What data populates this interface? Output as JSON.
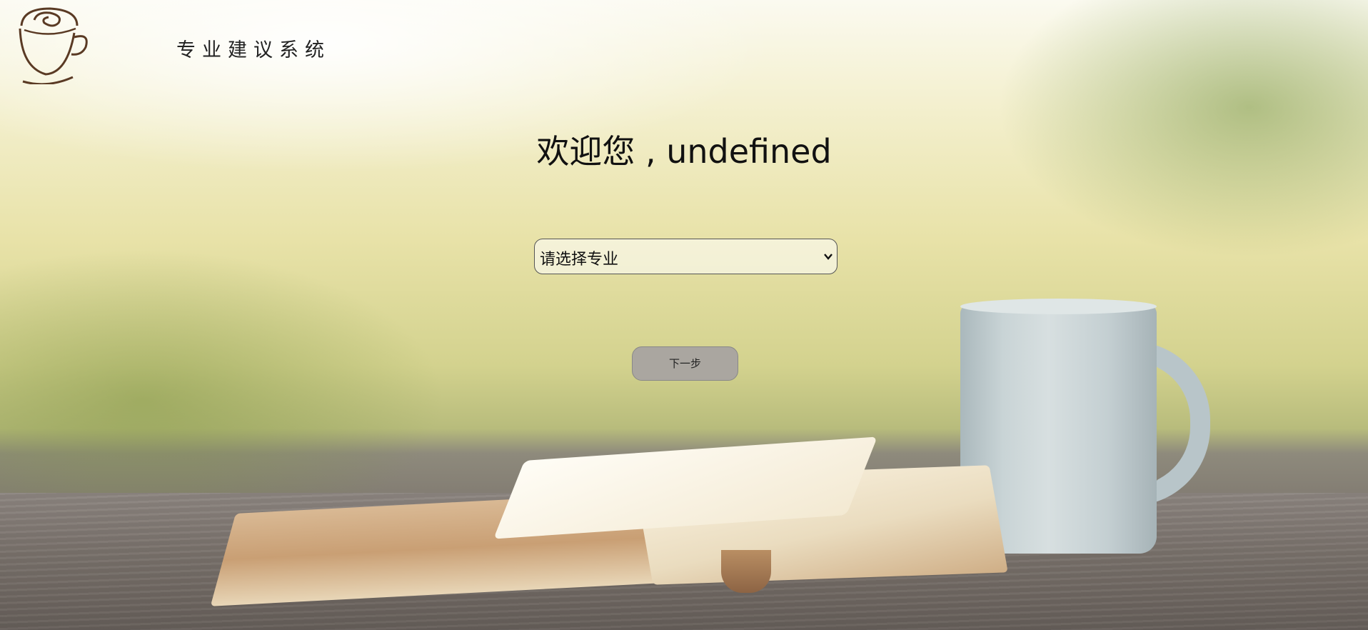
{
  "header": {
    "logo_icon": "coffee-cup-icon",
    "site_title": "专业建议系统"
  },
  "main": {
    "welcome_text": "欢迎您 , undefined",
    "major_select": {
      "selected_value": "请选择专业",
      "icon": "chevron-down-icon"
    },
    "next_button_label": "下一步"
  },
  "colors": {
    "button_bg": "#aaa6a0",
    "text": "#111111"
  }
}
